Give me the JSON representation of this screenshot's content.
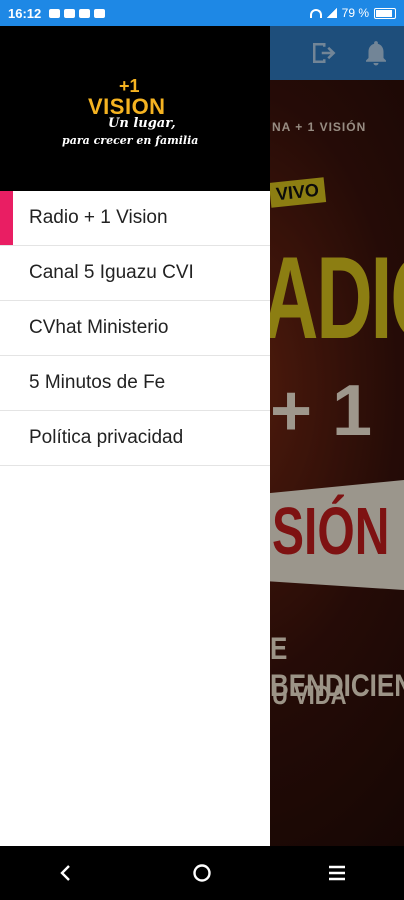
{
  "status_bar": {
    "time": "16:12",
    "battery": "79 %",
    "battery_level": 0.79
  },
  "app_bar": {
    "icons": [
      "exit-icon",
      "bell-icon"
    ]
  },
  "poster": {
    "small_text": "NA + 1 VISIÓN",
    "vivo": "VIVO",
    "radio": "ADIO",
    "plus_one": "+ 1",
    "vision": "SIÓN",
    "bless": "E BENDICIENDO",
    "life": "U VIDA"
  },
  "drawer": {
    "logo": {
      "plus_one": "+1",
      "vision": "VISION",
      "tagline1": "Un lugar,",
      "tagline2": "para crecer en familia"
    },
    "menu": [
      {
        "label": "Radio + 1 Vision",
        "active": true
      },
      {
        "label": "Canal 5 Iguazu CVI",
        "active": false
      },
      {
        "label": "CVhat Ministerio",
        "active": false
      },
      {
        "label": "5 Minutos de Fe",
        "active": false
      },
      {
        "label": "Política privacidad",
        "active": false
      }
    ]
  },
  "colors": {
    "status_bar": "#1e88e5",
    "app_bar": "#2f79bd",
    "active_indicator": "#e91e63",
    "logo_gold": "#f5b321"
  },
  "nav_bar": {
    "icons": [
      "back-icon",
      "home-icon",
      "recents-icon"
    ]
  }
}
